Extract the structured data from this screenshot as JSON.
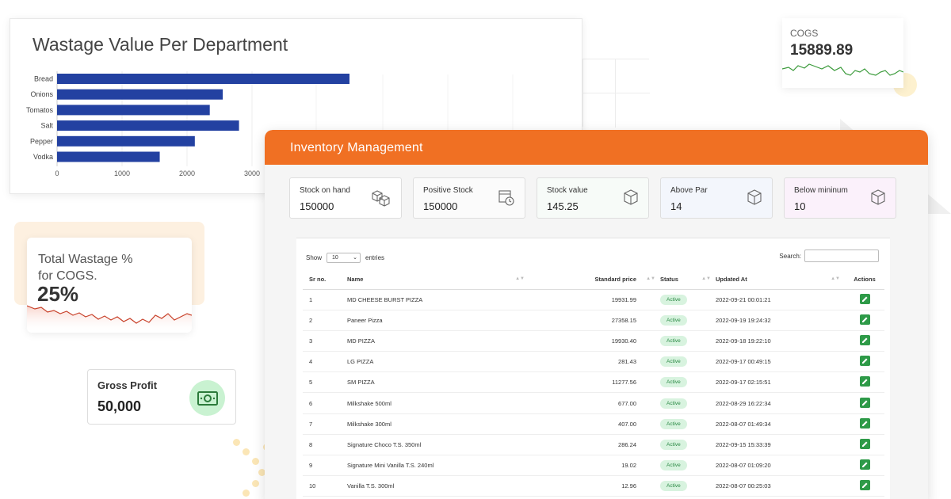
{
  "wastage_chart": {
    "chart_data": {
      "type": "bar",
      "orientation": "horizontal",
      "title": "Wastage Value Per Department",
      "categories": [
        "Bread",
        "Onions",
        "Tomatos",
        "Salt",
        "Pepper",
        "Vodka"
      ],
      "values": [
        4500,
        2550,
        2350,
        2800,
        2120,
        1580
      ],
      "xlim": [
        0,
        3000
      ],
      "xticks": [
        0,
        1000,
        2000,
        3000
      ],
      "bar_color": "#2341a1",
      "grid": true
    }
  },
  "cogs": {
    "label": "COGS",
    "value": "15889.89",
    "line_color": "#3a9a3a"
  },
  "wastage_pct": {
    "label_line1": "Total Wastage %",
    "label_line2": "for COGS.",
    "value": "25%",
    "line_color": "#c8412a"
  },
  "gross_profit": {
    "label": "Gross Profit",
    "value": "50,000",
    "icon": "money-icon",
    "icon_color": "#2b7a3a"
  },
  "inventory": {
    "title": "Inventory Management",
    "header_color": "#f07023",
    "stats": [
      {
        "label": "Stock on hand",
        "value": "150000",
        "icon": "boxes-icon"
      },
      {
        "label": "Positive Stock",
        "value": "150000",
        "icon": "stock-clock-icon"
      },
      {
        "label": "Stock value",
        "value": "145.25",
        "icon": "box-icon"
      },
      {
        "label": "Above Par",
        "value": "14",
        "icon": "box-icon"
      },
      {
        "label": "Below mininum",
        "value": "10",
        "icon": "box-icon"
      }
    ],
    "table": {
      "show_label": "Show",
      "entries_value": "10",
      "entries_label": "entries",
      "search_label": "Search:",
      "headers": {
        "sr": "Sr no.",
        "name": "Name",
        "price": "Standard price",
        "status": "Status",
        "updated": "Updated At",
        "actions": "Actions"
      },
      "rows": [
        {
          "sr": "1",
          "name": "MD CHEESE BURST PIZZA",
          "price": "19931.99",
          "status": "Active",
          "updated": "2022-09-21 00:01:21"
        },
        {
          "sr": "2",
          "name": "Paneer Pizza",
          "price": "27358.15",
          "status": "Active",
          "updated": "2022-09-19 19:24:32"
        },
        {
          "sr": "3",
          "name": "MD PIZZA",
          "price": "19930.40",
          "status": "Active",
          "updated": "2022-09-18 19:22:10"
        },
        {
          "sr": "4",
          "name": "LG PIZZA",
          "price": "281.43",
          "status": "Active",
          "updated": "2022-09-17 00:49:15"
        },
        {
          "sr": "5",
          "name": "SM PIZZA",
          "price": "11277.56",
          "status": "Active",
          "updated": "2022-09-17 02:15:51"
        },
        {
          "sr": "6",
          "name": "Milkshake 500ml",
          "price": "677.00",
          "status": "Active",
          "updated": "2022-08-29 16:22:34"
        },
        {
          "sr": "7",
          "name": "Milkshake 300ml",
          "price": "407.00",
          "status": "Active",
          "updated": "2022-08-07 01:49:34"
        },
        {
          "sr": "8",
          "name": "Signature Choco T.S. 350ml",
          "price": "286.24",
          "status": "Active",
          "updated": "2022-09-15 15:33:39"
        },
        {
          "sr": "9",
          "name": "Signature Mini Vanilla T.S. 240ml",
          "price": "19.02",
          "status": "Active",
          "updated": "2022-08-07 01:09:20"
        },
        {
          "sr": "10",
          "name": "Vanilla T.S. 300ml",
          "price": "12.96",
          "status": "Active",
          "updated": "2022-08-07 00:25:03"
        }
      ]
    }
  }
}
